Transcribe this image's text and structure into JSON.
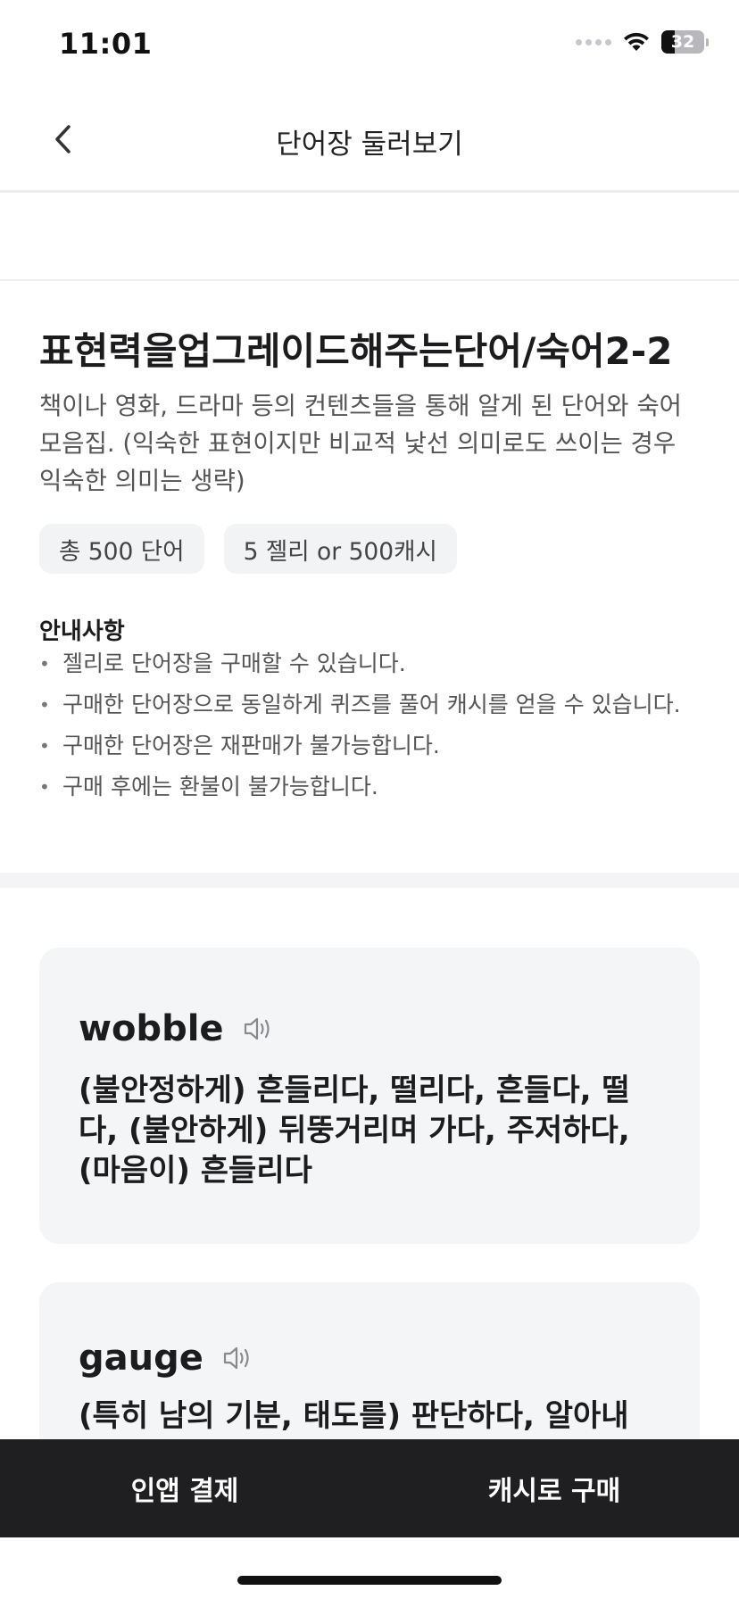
{
  "status_bar": {
    "time": "11:01",
    "battery_level": "32"
  },
  "nav": {
    "title": "단어장 둘러보기"
  },
  "wordbook": {
    "title": "표현력을업그레이드해주는단어/숙어2-2",
    "description": "책이나 영화, 드라마 등의 컨텐츠들을 통해 알게 된 단어와 숙어 모음집. (익숙한 표현이지만 비교적 낯선 의미로도 쓰이는 경우 익숙한 의미는 생략)",
    "chips": [
      "총 500 단어",
      "5 젤리 or 500캐시"
    ]
  },
  "notice": {
    "title": "안내사항",
    "items": [
      "젤리로 단어장을 구매할 수 있습니다.",
      "구매한 단어장으로 동일하게 퀴즈를 풀어 캐시를 얻을 수 있습니다.",
      "구매한 단어장은 재판매가 불가능합니다.",
      "구매 후에는 환불이 불가능합니다."
    ]
  },
  "words": [
    {
      "word": "wobble",
      "meaning": "(불안정하게) 흔들리다, 떨리다, 흔들다, 떨다, (불안하게) 뒤뚱거리며 가다, 주저하다, (마음이) 흔들리다"
    },
    {
      "word": "gauge",
      "meaning": "(특히 남의 기분, 태도를) 판단하다, 알아내다,"
    }
  ],
  "bottom_bar": {
    "in_app_label": "인앱 결제",
    "cash_label": "캐시로 구매"
  },
  "icons": {
    "back": "chevron-left-icon",
    "wifi": "wifi-icon",
    "speaker": "speaker-icon"
  }
}
